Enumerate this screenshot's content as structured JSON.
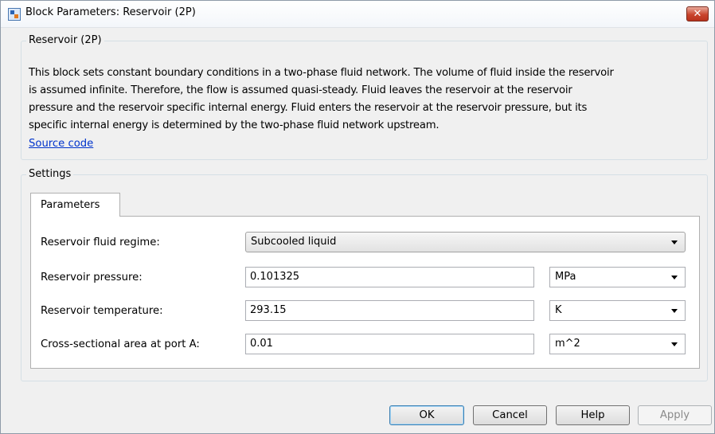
{
  "window": {
    "title": "Block Parameters: Reservoir (2P)",
    "close_label": "✕"
  },
  "block": {
    "group_title": "Reservoir (2P)",
    "description_lines": [
      "This block sets constant boundary conditions in a two-phase fluid network. The volume of fluid inside the reservoir",
      "is assumed infinite. Therefore, the flow is assumed quasi-steady. Fluid leaves the reservoir at the reservoir",
      "pressure and the reservoir specific internal energy. Fluid enters the reservoir at the reservoir pressure, but its",
      "specific internal energy is determined by the two-phase fluid network upstream."
    ],
    "source_link": "Source code"
  },
  "settings": {
    "group_title": "Settings",
    "tab_label": "Parameters",
    "rows": [
      {
        "label": "Reservoir fluid regime:",
        "value": "Subcooled liquid"
      },
      {
        "label": "Reservoir pressure:",
        "value": "0.101325",
        "unit": "MPa"
      },
      {
        "label": "Reservoir temperature:",
        "value": "293.15",
        "unit": "K"
      },
      {
        "label": "Cross-sectional area at port A:",
        "value": "0.01",
        "unit": "m^2"
      }
    ]
  },
  "buttons": {
    "ok": "OK",
    "cancel": "Cancel",
    "help": "Help",
    "apply": "Apply"
  },
  "colors": {
    "dialog_bg": "#f0f0f0",
    "link": "#0033cc",
    "close_button": "#c9452d",
    "ok_border": "#3c7fb1"
  },
  "icons": {
    "app": "simulink-block-icon",
    "close": "close-icon",
    "dropdown": "chevron-down-icon"
  }
}
